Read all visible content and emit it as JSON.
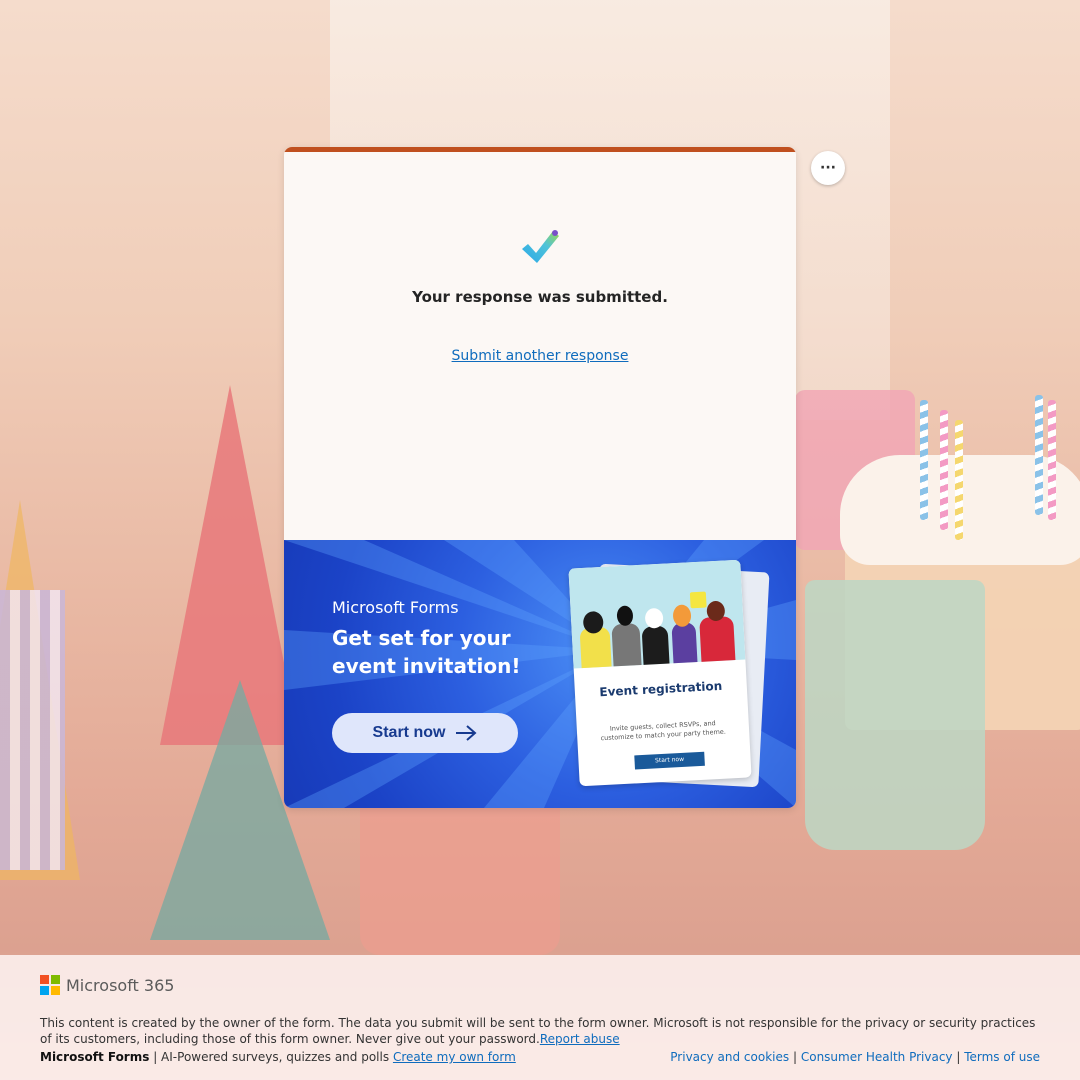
{
  "confirmation": {
    "message": "Your response was submitted.",
    "submit_another": "Submit another response"
  },
  "more_button": {
    "icon": "ellipsis-icon",
    "label": "···"
  },
  "promo": {
    "brand": "Microsoft Forms",
    "headline": "Get set for your event invitation!",
    "cta": "Start now",
    "mock_title": "Event registration",
    "mock_subtitle": "Invite guests, collect RSVPs, and customize to match your party theme.",
    "mock_button": "Start now"
  },
  "footer": {
    "logo_text": "Microsoft 365",
    "disclaimer": "This content is created by the owner of the form. The data you submit will be sent to the form owner. Microsoft is not responsible for the privacy or security practices of its customers, including those of this form owner. Never give out your password.",
    "report_abuse": "Report abuse",
    "product_name": "Microsoft Forms",
    "tagline": "| AI-Powered surveys, quizzes and polls",
    "create_form": "Create my own form",
    "links": [
      "Privacy and cookies",
      "Consumer Health Privacy",
      "Terms of use"
    ],
    "separator": "|"
  },
  "colors": {
    "accent_bar": "#c0501f",
    "link": "#0f6cbd",
    "promo_blue": "#2c5fe0"
  }
}
